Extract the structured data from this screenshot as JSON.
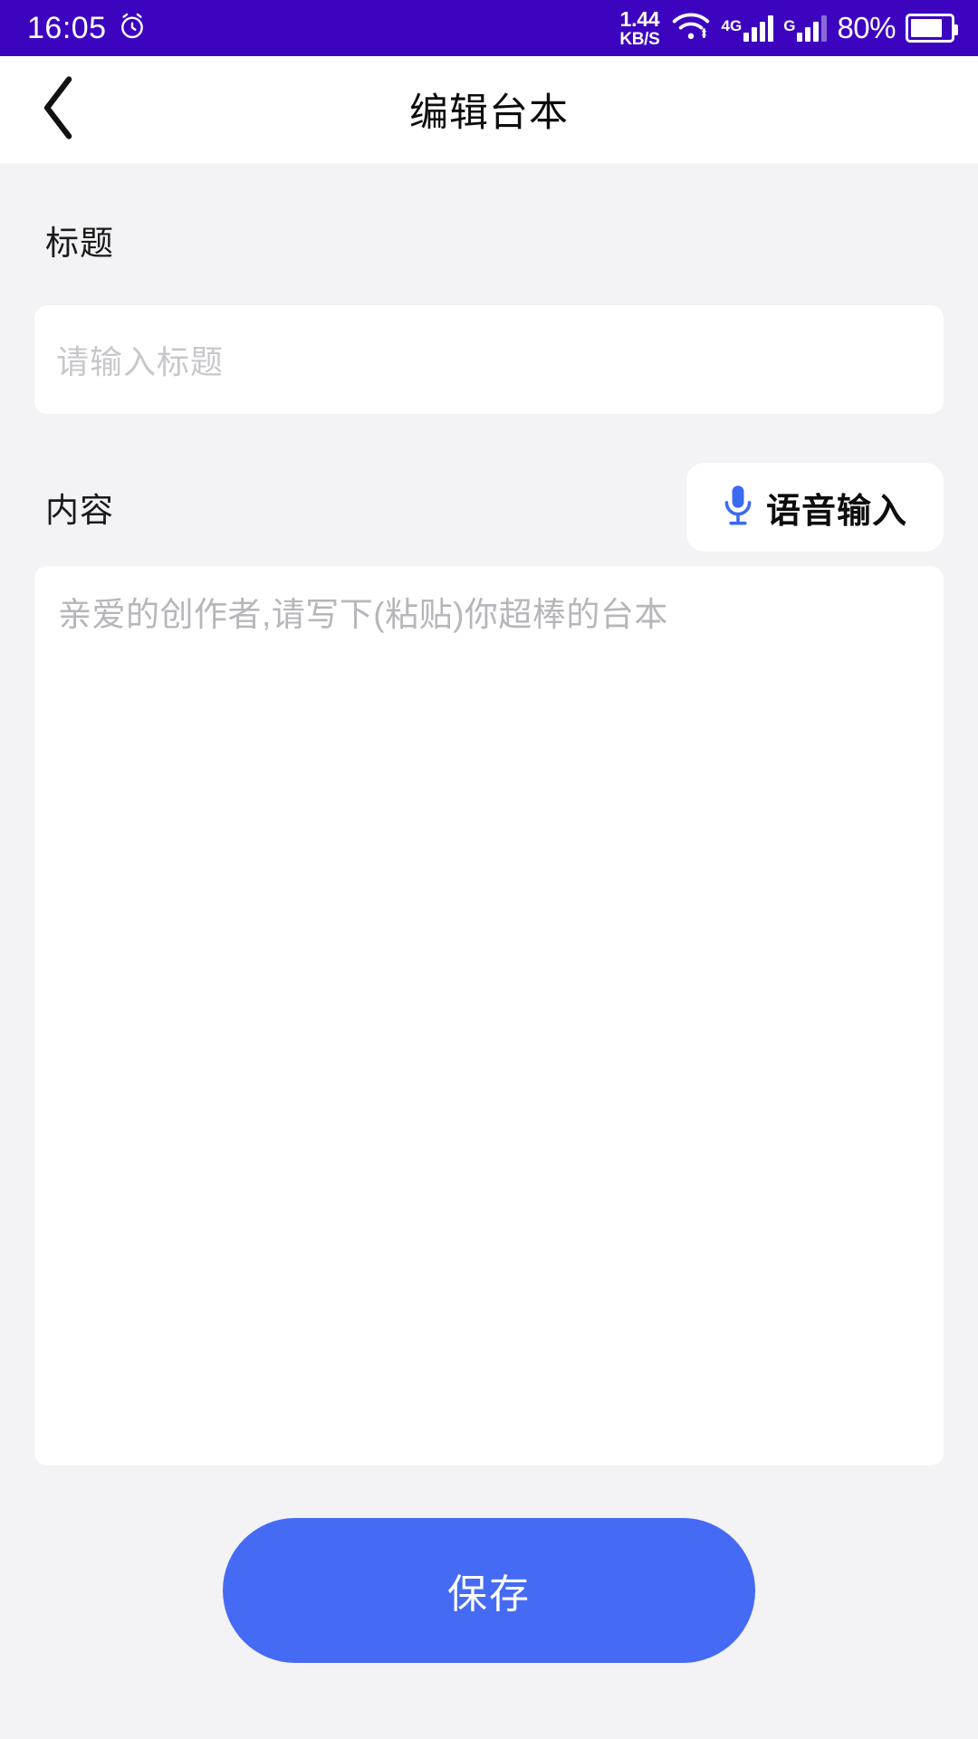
{
  "status_bar": {
    "time": "16:05",
    "alarm_icon": "alarm-clock-icon",
    "network_rate": "1.44",
    "network_unit": "KB/S",
    "wifi_icon": "wifi-icon",
    "sim1_label": "4G",
    "sim2_label": "G",
    "battery_percent": "80%",
    "battery_icon": "battery-icon",
    "background_color": "#3d04bf"
  },
  "nav_bar": {
    "back_icon": "chevron-left-icon",
    "title": "编辑台本"
  },
  "form": {
    "title_field": {
      "label": "标题",
      "value": "",
      "placeholder": "请输入标题"
    },
    "content_field": {
      "label": "内容",
      "value": "",
      "placeholder": "亲爱的创作者,请写下(粘贴)你超棒的台本"
    },
    "voice_button": {
      "label": "语音输入",
      "icon": "microphone-icon",
      "icon_color": "#3a6bf0"
    }
  },
  "footer": {
    "save_label": "保存",
    "save_color": "#456bf5"
  }
}
